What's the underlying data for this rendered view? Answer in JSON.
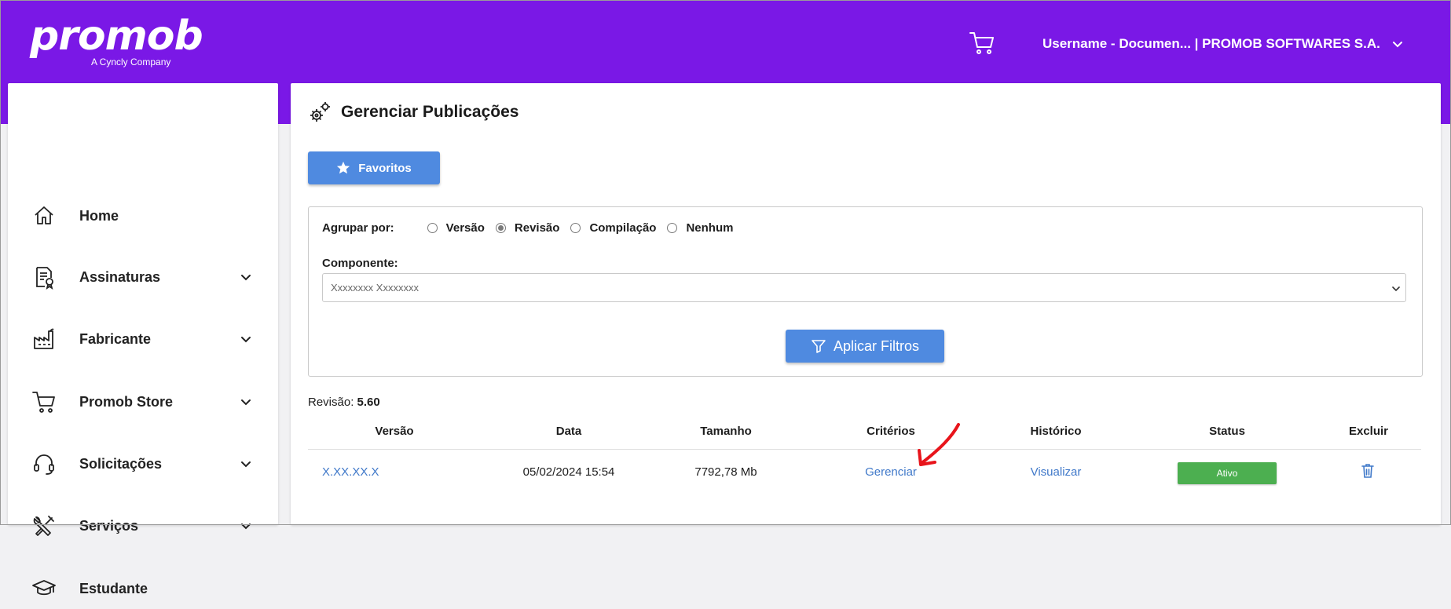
{
  "header": {
    "logo_text": "promob",
    "logo_sub": "A Cyncly Company",
    "user_label": "Username - Documen... | PROMOB SOFTWARES S.A."
  },
  "sidebar": {
    "items": [
      {
        "label": "Home",
        "icon": "home-icon",
        "expandable": false
      },
      {
        "label": "Assinaturas",
        "icon": "document-certificate-icon",
        "expandable": true
      },
      {
        "label": "Fabricante",
        "icon": "factory-icon",
        "expandable": true
      },
      {
        "label": "Promob Store",
        "icon": "cart-icon",
        "expandable": true
      },
      {
        "label": "Solicitações",
        "icon": "headset-icon",
        "expandable": true
      },
      {
        "label": "Serviços",
        "icon": "tools-icon",
        "expandable": true
      },
      {
        "label": "Estudante",
        "icon": "graduation-cap-icon",
        "expandable": false
      }
    ]
  },
  "page": {
    "title": "Gerenciar Publicações",
    "favorites_label": "Favoritos"
  },
  "filters": {
    "group_label": "Agrupar por:",
    "options": [
      {
        "label": "Versão",
        "checked": false
      },
      {
        "label": "Revisão",
        "checked": true
      },
      {
        "label": "Compilação",
        "checked": false
      },
      {
        "label": "Nenhum",
        "checked": false
      }
    ],
    "component_label": "Componente:",
    "component_value": "Xxxxxxxx Xxxxxxxx",
    "apply_label": "Aplicar Filtros"
  },
  "results": {
    "revision_label": "Revisão:",
    "revision_value": "5.60",
    "headers": [
      "Versão",
      "Data",
      "Tamanho",
      "Critérios",
      "Histórico",
      "Status",
      "Excluir"
    ],
    "rows": [
      {
        "version": "X.XX.XX.X",
        "date": "05/02/2024 15:54",
        "size": "7792,78 Mb",
        "criteria": "Gerenciar",
        "history": "Visualizar",
        "status": "Ativo"
      }
    ]
  },
  "colors": {
    "brand_purple": "#7a18e6",
    "button_blue": "#4f8ae0",
    "link_blue": "#3f78c9",
    "status_green": "#4caf50",
    "annotation_red": "#e8141b"
  }
}
